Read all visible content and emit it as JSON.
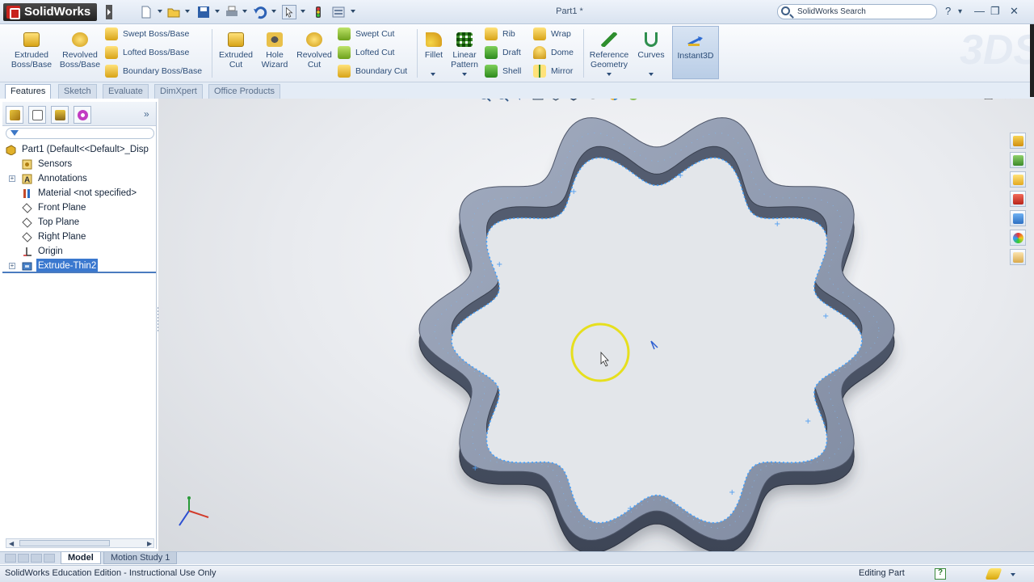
{
  "app": {
    "logo_text": "SolidWorks",
    "document_title": "Part1 *",
    "search_placeholder": "SolidWorks Search",
    "window_buttons": {
      "help": "?",
      "minimize": "—",
      "restore": "❐",
      "close": "✕",
      "help_drop": "▾"
    }
  },
  "command_manager": {
    "big_buttons": [
      {
        "label": "Extruded\nBoss/Base",
        "icon": "extruded-boss-icon"
      },
      {
        "label": "Revolved\nBoss/Base",
        "icon": "revolved-boss-icon"
      },
      {
        "label": "Extruded\nCut",
        "icon": "extruded-cut-icon"
      },
      {
        "label": "Hole\nWizard",
        "icon": "hole-wizard-icon"
      },
      {
        "label": "Revolved\nCut",
        "icon": "revolved-cut-icon"
      },
      {
        "label": "Fillet",
        "icon": "fillet-icon"
      },
      {
        "label": "Linear\nPattern",
        "icon": "linear-pattern-icon"
      },
      {
        "label": "Reference\nGeometry",
        "icon": "reference-geometry-icon"
      },
      {
        "label": "Curves",
        "icon": "curves-icon"
      },
      {
        "label": "Instant3D",
        "icon": "instant3d-icon"
      }
    ],
    "small_buttons": {
      "swept_boss": "Swept Boss/Base",
      "lofted_boss": "Lofted Boss/Base",
      "boundary_boss": "Boundary Boss/Base",
      "swept_cut": "Swept Cut",
      "lofted_cut": "Lofted Cut",
      "boundary_cut": "Boundary Cut",
      "rib": "Rib",
      "draft": "Draft",
      "shell": "Shell",
      "wrap": "Wrap",
      "dome": "Dome",
      "mirror": "Mirror"
    },
    "tabs": [
      "Features",
      "Sketch",
      "Evaluate",
      "DimXpert",
      "Office Products"
    ],
    "active_tab": "Features"
  },
  "feature_manager": {
    "tabs": [
      "feature-manager",
      "property-manager",
      "configuration-manager",
      "dimxpert-manager"
    ],
    "expand_glyph": "»",
    "tree": [
      {
        "label": "Part1  (Default<<Default>_Disp",
        "icon": "part-icon"
      },
      {
        "label": "Sensors",
        "icon": "sensors-icon"
      },
      {
        "label": "Annotations",
        "icon": "annotations-icon",
        "expandable": true
      },
      {
        "label": "Material <not specified>",
        "icon": "material-icon"
      },
      {
        "label": "Front Plane",
        "icon": "plane-icon"
      },
      {
        "label": "Top Plane",
        "icon": "plane-icon"
      },
      {
        "label": "Right Plane",
        "icon": "plane-icon"
      },
      {
        "label": "Origin",
        "icon": "origin-icon"
      },
      {
        "label": "Extrude-Thin2",
        "icon": "extrude-thin-icon",
        "expandable": true,
        "selected": true
      }
    ]
  },
  "bottom_tabs": {
    "model": "Model",
    "motion_study": "Motion Study 1"
  },
  "status_bar": {
    "left_text": "SolidWorks Education Edition - Instructional Use Only",
    "right_text": "Editing Part"
  },
  "colors": {
    "accent_blue": "#3a78cf",
    "part_body": "#8893a8",
    "part_edge_highlight": "#3fa0ff",
    "cursor_ring": "#e6df1e"
  }
}
